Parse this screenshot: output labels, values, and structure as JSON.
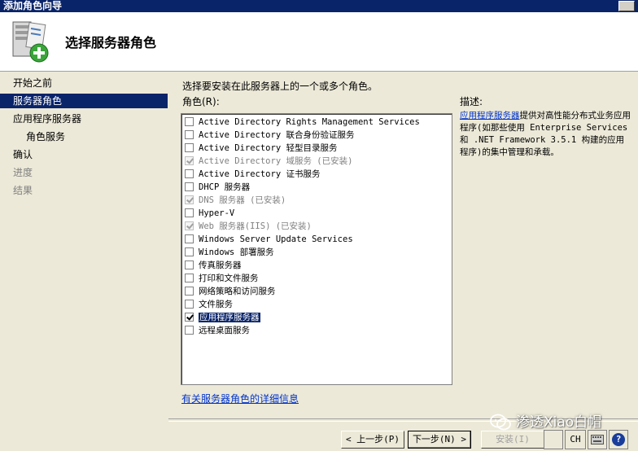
{
  "window": {
    "title": "添加角色向导"
  },
  "header": {
    "page_title": "选择服务器角色"
  },
  "nav": [
    {
      "label": "开始之前",
      "state": "normal",
      "level": 0
    },
    {
      "label": "服务器角色",
      "state": "active",
      "level": 0
    },
    {
      "label": "应用程序服务器",
      "state": "normal",
      "level": 0
    },
    {
      "label": "角色服务",
      "state": "normal",
      "level": 1
    },
    {
      "label": "确认",
      "state": "normal",
      "level": 0
    },
    {
      "label": "进度",
      "state": "disabled",
      "level": 0
    },
    {
      "label": "结果",
      "state": "disabled",
      "level": 0
    }
  ],
  "main": {
    "instruction": "选择要安装在此服务器上的一个或多个角色。",
    "roles_label": "角色(R):",
    "description_label": "描述:",
    "more_info_link": "有关服务器角色的详细信息"
  },
  "roles": [
    {
      "label": "Active Directory Rights Management Services",
      "checked": false,
      "installed": false
    },
    {
      "label": "Active Directory 联合身份验证服务",
      "checked": false,
      "installed": false
    },
    {
      "label": "Active Directory 轻型目录服务",
      "checked": false,
      "installed": false
    },
    {
      "label": "Active Directory 域服务  (已安装)",
      "checked": true,
      "installed": true
    },
    {
      "label": "Active Directory 证书服务",
      "checked": false,
      "installed": false
    },
    {
      "label": "DHCP 服务器",
      "checked": false,
      "installed": false
    },
    {
      "label": "DNS 服务器  (已安装)",
      "checked": true,
      "installed": true
    },
    {
      "label": "Hyper-V",
      "checked": false,
      "installed": false
    },
    {
      "label": "Web 服务器(IIS)  (已安装)",
      "checked": true,
      "installed": true
    },
    {
      "label": "Windows Server Update Services",
      "checked": false,
      "installed": false
    },
    {
      "label": "Windows 部署服务",
      "checked": false,
      "installed": false
    },
    {
      "label": "传真服务器",
      "checked": false,
      "installed": false
    },
    {
      "label": "打印和文件服务",
      "checked": false,
      "installed": false
    },
    {
      "label": "网络策略和访问服务",
      "checked": false,
      "installed": false
    },
    {
      "label": "文件服务",
      "checked": false,
      "installed": false
    },
    {
      "label": "应用程序服务器",
      "checked": true,
      "installed": false,
      "selected": true
    },
    {
      "label": "远程桌面服务",
      "checked": false,
      "installed": false
    }
  ],
  "description": {
    "link": "应用程序服务器",
    "text": "提供对高性能分布式业务应用程序(如那些使用 Enterprise Services 和 .NET Framework 3.5.1 构建的应用程序)的集中管理和承载。"
  },
  "buttons": {
    "prev": "< 上一步(P)",
    "next": "下一步(N) >",
    "install": "安装(I)"
  },
  "tray": {
    "lang": "CH",
    "help": "?"
  },
  "watermark": {
    "text": "渗透Xiao白帽"
  },
  "colors": {
    "title_bar": "#0a246a",
    "selection": "#0a246a",
    "link": "#0033cc",
    "face": "#ece9d8"
  }
}
